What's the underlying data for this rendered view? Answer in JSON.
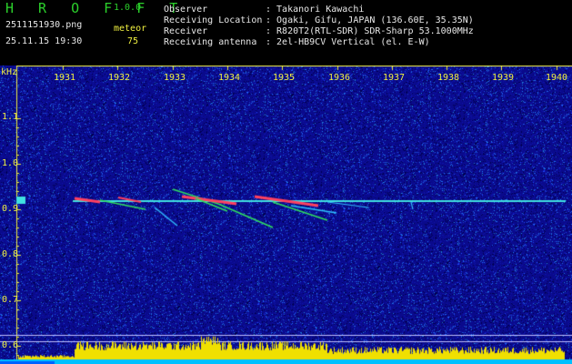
{
  "header": {
    "app_name": "H R O F F T",
    "version": "1.0.0",
    "filename": "2511151930.png",
    "datetime": "25.11.15 19:30",
    "meteor_label": "meteor",
    "meteor_count": "75",
    "info": [
      {
        "label": "Observer",
        "value": ": Takanori Kawachi"
      },
      {
        "label": "Receiving Location",
        "value": ": Ogaki, Gifu, JAPAN (136.60E, 35.35N)"
      },
      {
        "label": "Receiver",
        "value": ": R820T2(RTL-SDR) SDR-Sharp 53.1000MHz"
      },
      {
        "label": "Receiving antenna",
        "value": ": 2el-HB9CV Vertical (el. E-W)"
      }
    ]
  },
  "chart_data": {
    "type": "heatmap",
    "ylabel": "kHz",
    "y_ticks": [
      "1.1",
      "1.0",
      "0.9",
      "0.8",
      "0.7",
      "0.6"
    ],
    "x_ticks": [
      "1931",
      "1932",
      "1933",
      "1934",
      "1935",
      "1936",
      "1937",
      "1938",
      "1939",
      "1940"
    ],
    "carrier_khz": 0.92,
    "colors": {
      "background": "#0a0a8c",
      "axis": "#f0f040",
      "carrier": "#40e0e0",
      "meteor_hot": "#ff4060",
      "meteor_warm": "#30e060",
      "spectrum_fill": "#f0e000",
      "spectrum_base": "#00c0ff"
    }
  }
}
